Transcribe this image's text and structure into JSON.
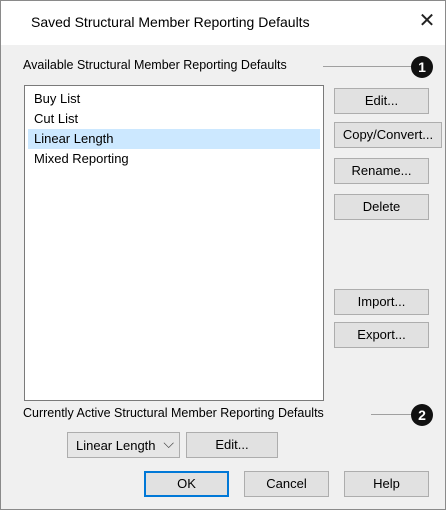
{
  "dialog": {
    "title": "Saved Structural Member Reporting Defaults",
    "close_icon": "close-icon"
  },
  "available": {
    "label": "Available Structural Member Reporting Defaults",
    "callout": "1",
    "items": [
      "Buy List",
      "Cut List",
      "Linear Length",
      "Mixed Reporting"
    ],
    "selected_index": 2
  },
  "side_buttons": {
    "edit": "Edit...",
    "copy_convert": "Copy/Convert...",
    "rename": "Rename...",
    "delete": "Delete",
    "import": "Import...",
    "export": "Export..."
  },
  "active": {
    "label": "Currently Active Structural Member Reporting Defaults",
    "callout": "2",
    "selected_value": "Linear Length",
    "edit": "Edit..."
  },
  "footer": {
    "ok": "OK",
    "cancel": "Cancel",
    "help": "Help"
  },
  "colors": {
    "selection": "#cce8ff",
    "default_button_border": "#0078d7",
    "callout_fill": "#111111"
  }
}
